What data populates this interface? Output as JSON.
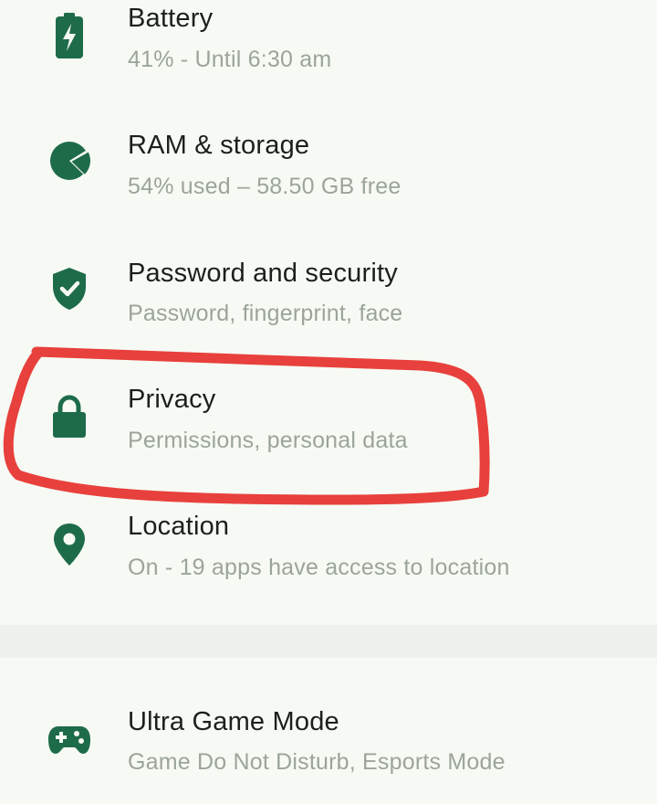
{
  "settings": {
    "items": [
      {
        "icon": "battery-icon",
        "title": "Battery",
        "subtitle": "41% - Until 6:30 am"
      },
      {
        "icon": "ram-storage-icon",
        "title": "RAM & storage",
        "subtitle": "54% used – 58.50 GB free"
      },
      {
        "icon": "shield-check-icon",
        "title": "Password and security",
        "subtitle": "Password, fingerprint, face"
      },
      {
        "icon": "lock-icon",
        "title": "Privacy",
        "subtitle": "Permissions, personal data"
      },
      {
        "icon": "location-pin-icon",
        "title": "Location",
        "subtitle": "On - 19 apps have access to location"
      },
      {
        "icon": "gamepad-icon",
        "title": "Ultra Game Mode",
        "subtitle": "Game Do Not Disturb, Esports Mode"
      }
    ]
  },
  "colors": {
    "background": "#f7faf4",
    "icon": "#1e6b4a",
    "title": "#1c1f1c",
    "subtitle": "#9ba49b",
    "annotation": "#e8403c",
    "divider": "#eef1ec"
  }
}
